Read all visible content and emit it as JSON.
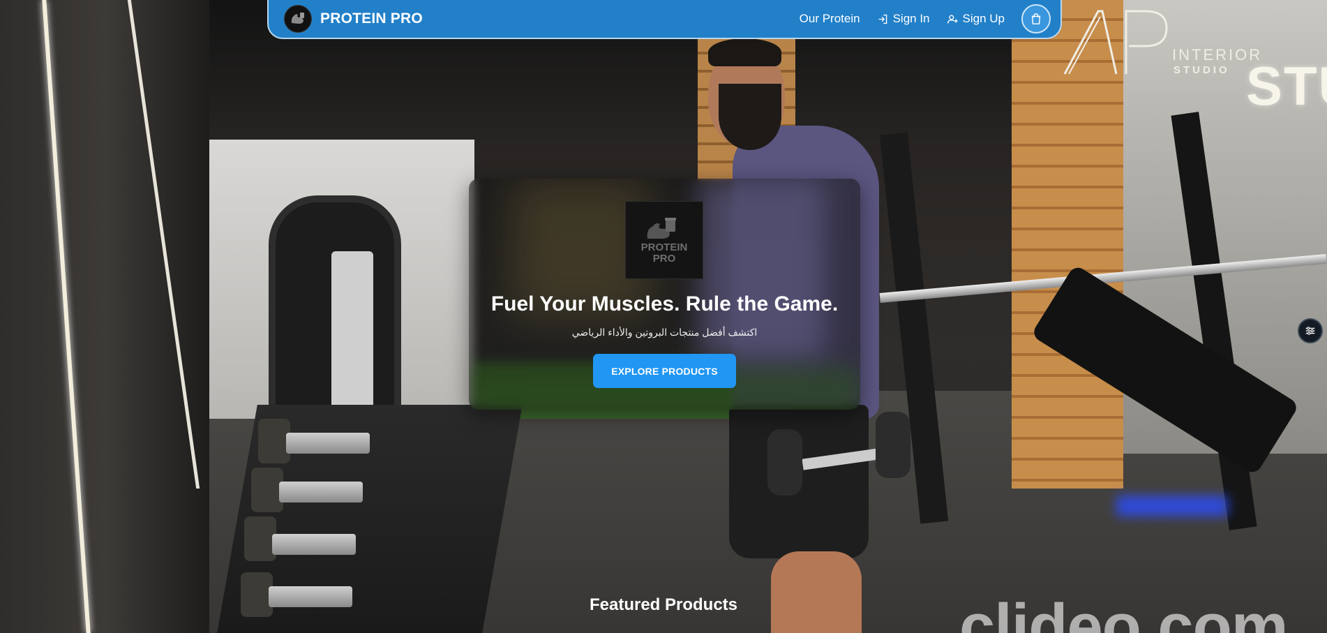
{
  "navbar": {
    "brand": "PROTEIN PRO",
    "links": [
      {
        "label": "Our Protein",
        "icon": "none"
      },
      {
        "label": "Sign In",
        "icon": "sign-in-icon"
      },
      {
        "label": "Sign Up",
        "icon": "user-plus-icon"
      }
    ],
    "cart_icon": "shopping-bag-icon",
    "colors": {
      "bar": "#2280c9",
      "cart": "#3a97de"
    }
  },
  "hero": {
    "logo_text_line1": "PROTEIN",
    "logo_text_line2": "PRO",
    "title": "Fuel Your Muscles. Rule the Game.",
    "subtitle": "اكتشف أفضل منتجات البروتين والأداء الرياضي",
    "cta_label": "EXPLORE PRODUCTS",
    "cta_color": "#2196f3"
  },
  "sections": {
    "featured_heading": "Featured Products"
  },
  "watermarks": {
    "ap_interior": "INTERIOR",
    "ap_studio": "STUDIO",
    "wall_sign": "STU",
    "video_watermark": "clideo.com"
  },
  "side_toggle_icon": "sliders-icon"
}
